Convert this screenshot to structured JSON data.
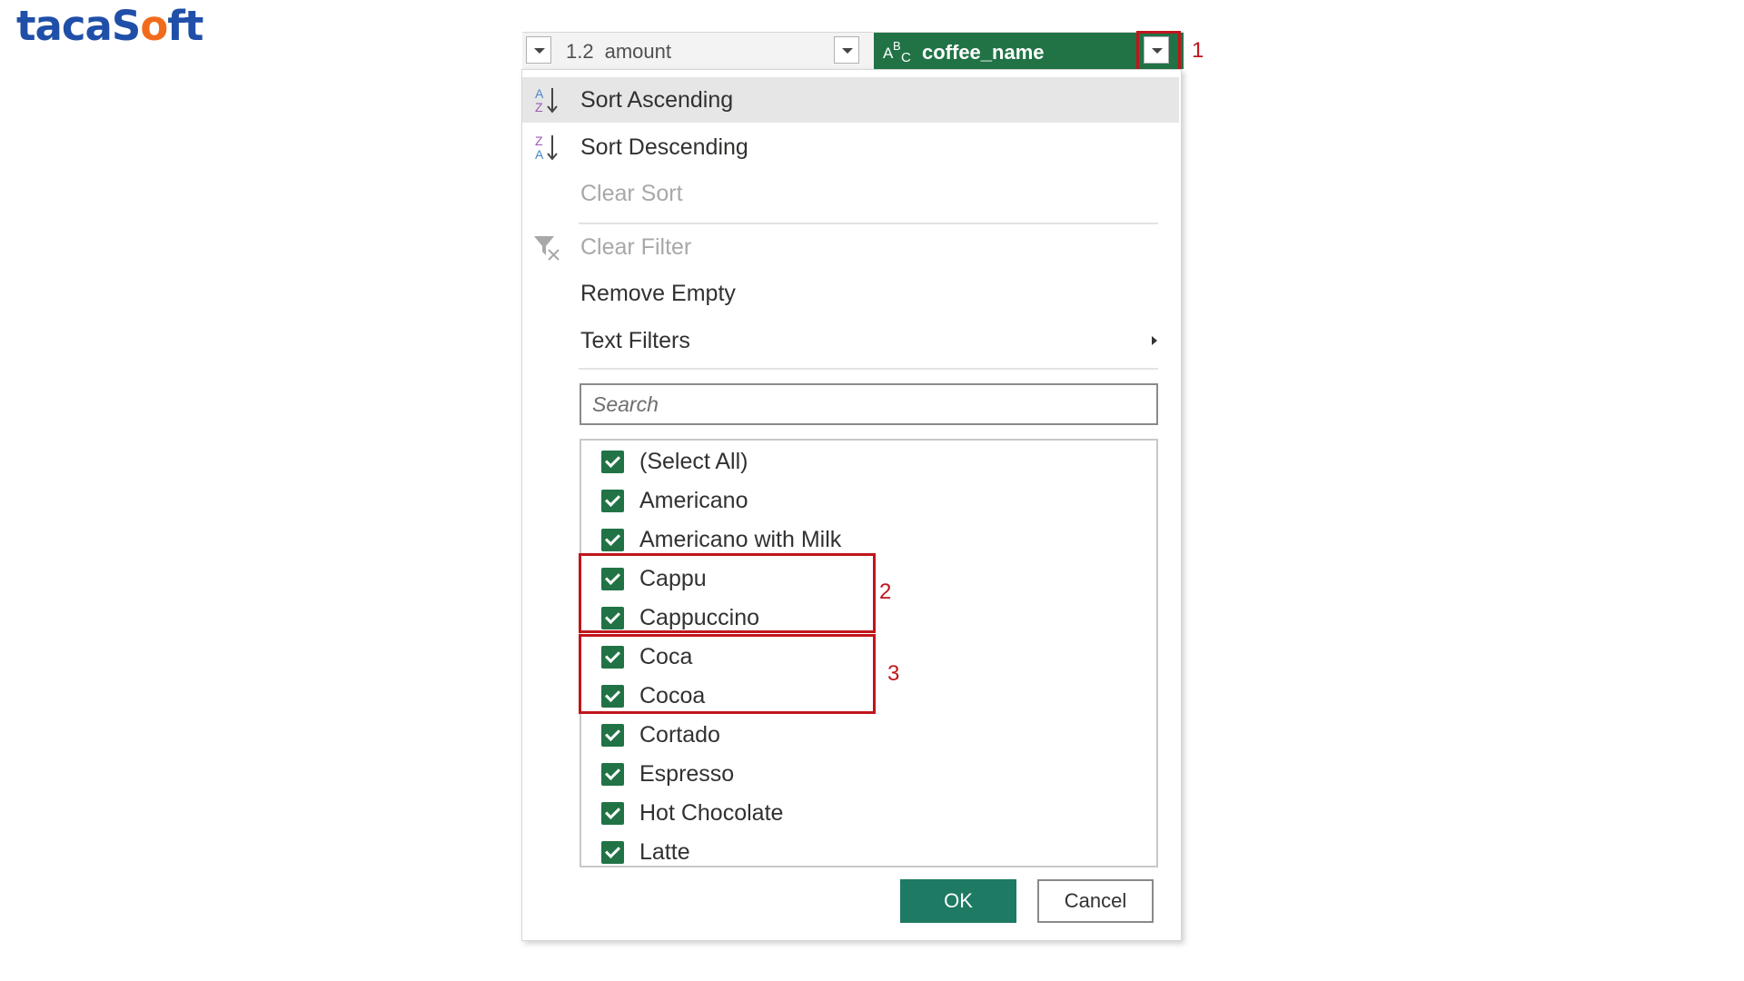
{
  "brand": {
    "logo_pre": "taca",
    "logo_accent": "S",
    "logo_mid": "o",
    "logo_post": "ft"
  },
  "header": {
    "amount": {
      "type_icon": "1.2",
      "label": "amount"
    },
    "coffee_name": {
      "type_icon_name": "abc-text-type-icon",
      "label": "coffee_name"
    }
  },
  "annotations": {
    "one": "1",
    "two": "2",
    "three": "3"
  },
  "menu": {
    "sort_ascending": "Sort Ascending",
    "sort_descending": "Sort Descending",
    "clear_sort": "Clear Sort",
    "clear_filter": "Clear Filter",
    "remove_empty": "Remove Empty",
    "text_filters": "Text Filters"
  },
  "search": {
    "placeholder": "Search"
  },
  "list": {
    "items": [
      {
        "label": "(Select All)",
        "checked": true
      },
      {
        "label": "Americano",
        "checked": true
      },
      {
        "label": "Americano with Milk",
        "checked": true
      },
      {
        "label": "Cappu",
        "checked": true
      },
      {
        "label": "Cappuccino",
        "checked": true
      },
      {
        "label": "Coca",
        "checked": true
      },
      {
        "label": "Cocoa",
        "checked": true
      },
      {
        "label": "Cortado",
        "checked": true
      },
      {
        "label": "Espresso",
        "checked": true
      },
      {
        "label": "Hot Chocolate",
        "checked": true
      },
      {
        "label": "Latte",
        "checked": true
      }
    ]
  },
  "buttons": {
    "ok": "OK",
    "cancel": "Cancel"
  },
  "colors": {
    "accent": "#217346",
    "ok_button": "#1e7a63",
    "annotation": "#c0161c",
    "logo": "#1f4fa8",
    "logo_accent": "#f26b1d"
  }
}
